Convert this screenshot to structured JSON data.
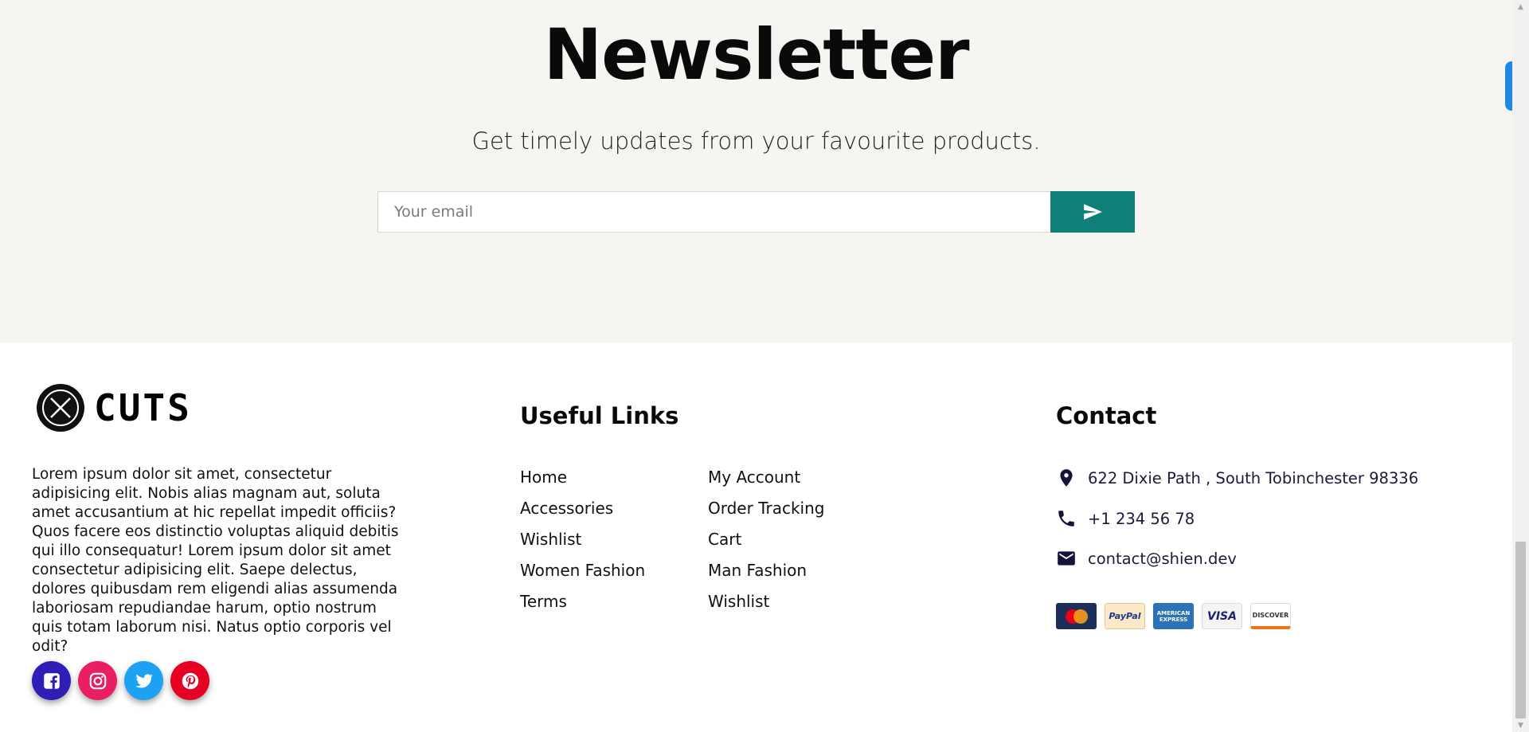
{
  "newsletter": {
    "title": "Newsletter",
    "subtitle": "Get timely updates from your favourite products.",
    "email_placeholder": "Your email",
    "send_icon": "send-icon"
  },
  "footer": {
    "logo_text": "CUTS",
    "about": "Lorem ipsum dolor sit amet, consectetur adipisicing elit. Nobis alias magnam aut, soluta amet accusantium at hic repellat impedit officiis? Quos facere eos distinctio voluptas aliquid debitis qui illo consequatur! Lorem ipsum dolor sit amet consectetur adipisicing elit. Saepe delectus, dolores quibusdam rem eligendi alias assumenda laboriosam repudiandae harum, optio nostrum quis totam laborum nisi. Natus optio corporis vel odit?",
    "social": [
      {
        "name": "facebook",
        "icon": "facebook-icon",
        "color": "#2d1fb5"
      },
      {
        "name": "instagram",
        "icon": "instagram-icon",
        "color": "#e91e63"
      },
      {
        "name": "twitter",
        "icon": "twitter-icon",
        "color": "#1da1f2"
      },
      {
        "name": "pinterest",
        "icon": "pinterest-icon",
        "color": "#e60023"
      }
    ],
    "useful_links": {
      "title": "Useful Links",
      "col1": [
        "Home",
        "Accessories",
        "Wishlist",
        "Women Fashion",
        "Terms"
      ],
      "col2": [
        "My Account",
        "Order Tracking",
        "Cart",
        "Man Fashion",
        "Wishlist"
      ]
    },
    "contact": {
      "title": "Contact",
      "address": "622 Dixie Path , South Tobinchester 98336",
      "phone": "+1 234 56 78",
      "email": "contact@shien.dev",
      "payment_cards": [
        "MasterCard",
        "PayPal",
        "AMERICAN EXPRESS",
        "VISA",
        "DISCOVER"
      ]
    }
  },
  "colors": {
    "newsletter_bg": "#f6f5f1",
    "send_button": "#0f8079",
    "side_tab": "#1e88e5"
  }
}
